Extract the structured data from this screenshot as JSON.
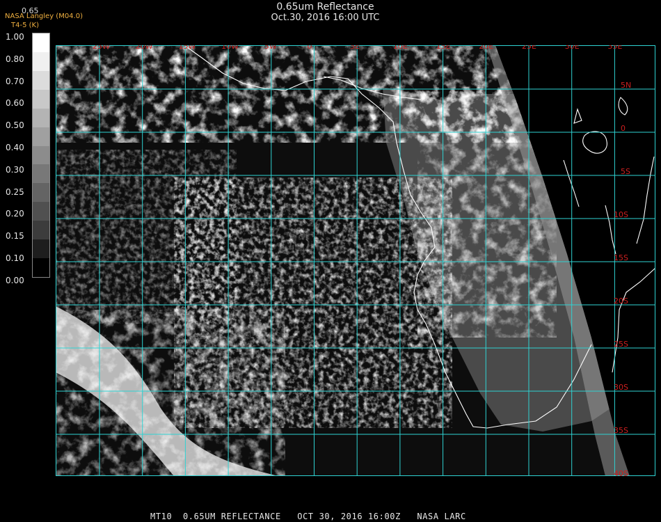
{
  "header": {
    "title": "0.65um Reflectance",
    "subtitle": "Oct.30, 2016 16:00 UTC"
  },
  "credits": {
    "top_value": "0.65",
    "source": "NASA Langley (M04.0)",
    "channel": "T4-5 (K)"
  },
  "legend": {
    "labels": [
      "1.00",
      "0.80",
      "0.70",
      "0.60",
      "0.50",
      "0.40",
      "0.30",
      "0.25",
      "0.20",
      "0.15",
      "0.10",
      "0.00"
    ],
    "colors": [
      "#ffffff",
      "#f0f0f0",
      "#dcdcdc",
      "#c8c8c8",
      "#b4b4b4",
      "#a0a0a0",
      "#8c8c8c",
      "#787878",
      "#646464",
      "#505050",
      "#3c3c3c",
      "#1e1e1e",
      "#000000"
    ]
  },
  "map": {
    "grid_color": "#2fd3d3",
    "label_color": "#cc1f1f",
    "coastline_color": "#ffffff",
    "longitude_labels": [
      "25W",
      "20W",
      "15W",
      "10W",
      "5W",
      "0",
      "5E",
      "10E",
      "15E",
      "20E",
      "25E",
      "30E",
      "35E"
    ],
    "latitude_labels": [
      "5N",
      "0",
      "5S",
      "10S",
      "15S",
      "20S",
      "25S",
      "30S",
      "35S",
      "40S"
    ]
  },
  "footer": {
    "text": "MT10  0.65UM REFLECTANCE   OCT 30, 2016 16:00Z   NASA LARC"
  }
}
